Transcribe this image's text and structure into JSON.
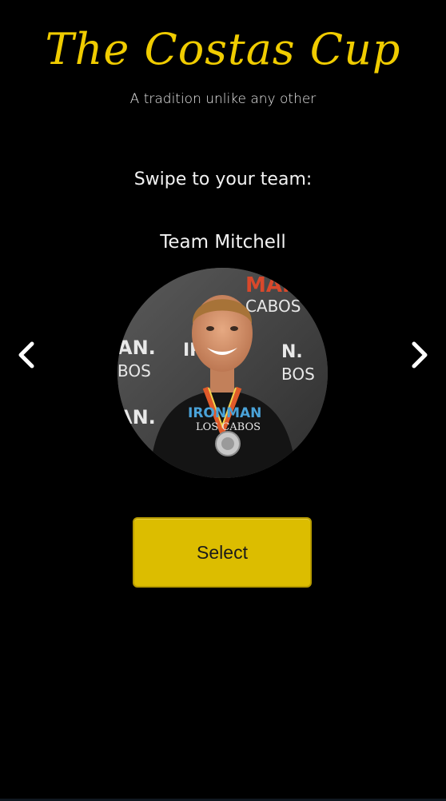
{
  "header": {
    "title": "The Costas Cup",
    "subtitle": "A tradition unlike any other"
  },
  "selector": {
    "prompt": "Swipe to your team:",
    "team_name": "Team Mitchell",
    "prev_icon": "chevron-left-icon",
    "next_icon": "chevron-right-icon",
    "photo_text": {
      "brand_top_left": "AN.",
      "brand_top_mid": "IRON",
      "brand_top_right": "MAN",
      "cabos_top": "CABOS",
      "bos_left": "BOS",
      "bos_right": "BOS",
      "left_bottom": "AN.",
      "right_bottom": "N.",
      "shirt_brand": "IRONMAN",
      "shirt_location": "LOS CABOS"
    }
  },
  "actions": {
    "select_label": "Select"
  },
  "colors": {
    "background": "#000000",
    "accent": "#f0cc00",
    "button": "#dcbd00",
    "text": "#f2f2f2"
  }
}
